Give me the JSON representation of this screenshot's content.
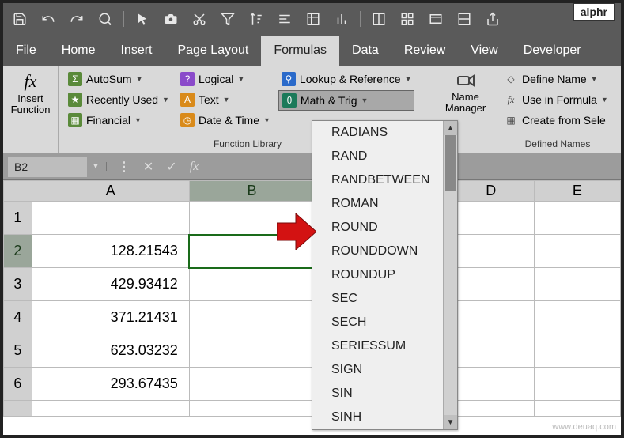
{
  "brand": "alphr",
  "watermark": "www.deuaq.com",
  "menu": {
    "file": "File",
    "home": "Home",
    "insert": "Insert",
    "page_layout": "Page Layout",
    "formulas": "Formulas",
    "data": "Data",
    "review": "Review",
    "view": "View",
    "developer": "Developer"
  },
  "ribbon": {
    "insert_function": "Insert\nFunction",
    "autosum": "AutoSum",
    "recently_used": "Recently Used",
    "financial": "Financial",
    "logical": "Logical",
    "text": "Text",
    "date_time": "Date & Time",
    "lookup_ref": "Lookup & Reference",
    "math_trig": "Math & Trig",
    "function_library": "Function Library",
    "name_manager": "Name\nManager",
    "define_name": "Define Name",
    "use_in_formula": "Use in Formula",
    "create_from_selection": "Create from Sele",
    "defined_names": "Defined Names"
  },
  "namebox": "B2",
  "columns": [
    "A",
    "B",
    "D",
    "E"
  ],
  "rows": [
    "1",
    "2",
    "3",
    "4",
    "5",
    "6"
  ],
  "cells": {
    "A2": "128.21543",
    "A3": "429.93412",
    "A4": "371.21431",
    "A5": "623.03232",
    "A6": "293.67435"
  },
  "dropdown": {
    "items": [
      "RADIANS",
      "RAND",
      "RANDBETWEEN",
      "ROMAN",
      "ROUND",
      "ROUNDDOWN",
      "ROUNDUP",
      "SEC",
      "SECH",
      "SERIESSUM",
      "SIGN",
      "SIN",
      "SINH"
    ]
  }
}
